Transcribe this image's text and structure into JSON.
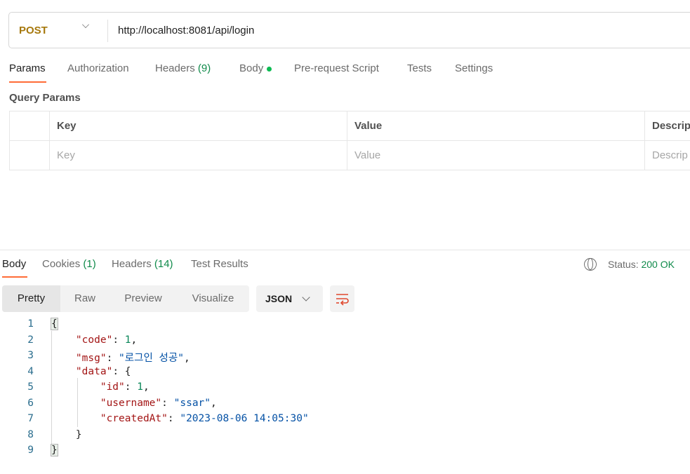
{
  "request": {
    "method": "POST",
    "url": "http://localhost:8081/api/login"
  },
  "request_tabs": [
    {
      "label": "Params"
    },
    {
      "label": "Authorization"
    },
    {
      "label": "Headers",
      "count": "(9)"
    },
    {
      "label": "Body"
    },
    {
      "label": "Pre-request Script"
    },
    {
      "label": "Tests"
    },
    {
      "label": "Settings"
    }
  ],
  "query_params": {
    "title": "Query Params",
    "headers": [
      "Key",
      "Value",
      "Descrip"
    ],
    "placeholders": [
      "Key",
      "Value",
      "Descrip"
    ]
  },
  "response_tabs": [
    {
      "label": "Body"
    },
    {
      "label": "Cookies",
      "count": "(1)"
    },
    {
      "label": "Headers",
      "count": "(14)"
    },
    {
      "label": "Test Results"
    }
  ],
  "status": {
    "label": "Status:",
    "value": "200 OK"
  },
  "view_modes": [
    "Pretty",
    "Raw",
    "Preview",
    "Visualize"
  ],
  "format": "JSON",
  "line_numbers": [
    "1",
    "2",
    "3",
    "4",
    "5",
    "6",
    "7",
    "8",
    "9"
  ],
  "json_body": {
    "code_key": "\"code\"",
    "code_val": "1",
    "msg_key": "\"msg\"",
    "msg_val": "\"로그인 성공\"",
    "data_key": "\"data\"",
    "id_key": "\"id\"",
    "id_val": "1",
    "username_key": "\"username\"",
    "username_val": "\"ssar\"",
    "createdAt_key": "\"createdAt\"",
    "createdAt_val": "\"2023-08-06 14:05:30\""
  },
  "colors": {
    "accent": "#ff6c37",
    "method": "#a6780c",
    "status_ok": "#0f8a4a"
  }
}
